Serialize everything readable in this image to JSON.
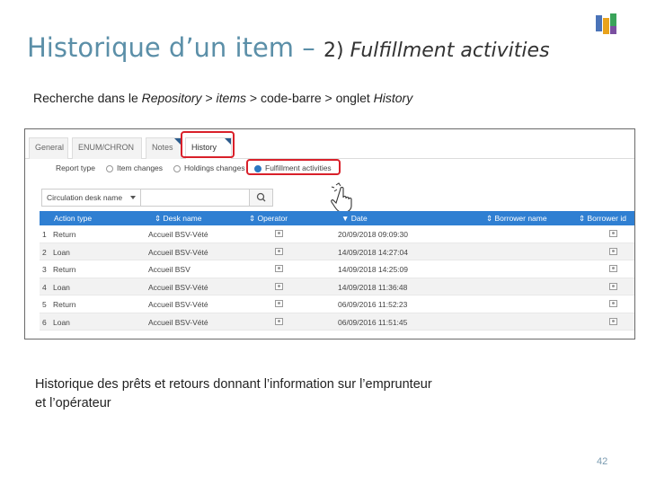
{
  "slide": {
    "title_main": "Historique d’un item – ",
    "title_num": "2) ",
    "title_italic": "Fulfillment activities",
    "subtitle_prefix": "Recherche dans le ",
    "subtitle_repo": "Repository",
    "subtitle_mid": " > ",
    "subtitle_items": "items",
    "subtitle_rest": " > code-barre > onglet ",
    "subtitle_history": "History",
    "body_line1": "Historique des prêts et retours donnant l’information sur l’emprunteur",
    "body_line2": "et l’opérateur",
    "page_number": "42",
    "accent_color": "#5b8fa8",
    "highlight_color": "#d9202a"
  },
  "screenshot": {
    "tabs": [
      "General",
      "ENUM/CHRON",
      "Notes",
      "History"
    ],
    "active_tab": "History",
    "report_type_label": "Report type",
    "report_options": [
      "Item changes",
      "Holdings changes",
      "Fulfillment activities"
    ],
    "selected_report": "Fulfillment activities",
    "filter_dropdown": "Circulation desk name",
    "search_icon": "search-icon",
    "columns": [
      "Action type",
      "Desk name",
      "Operator",
      "Date",
      "Borrower name",
      "Borrower id"
    ],
    "sort_column": "Date",
    "rows": [
      {
        "n": "1",
        "action": "Return",
        "desk": "Accueil BSV-Vété",
        "date": "20/09/2018 09:09:30"
      },
      {
        "n": "2",
        "action": "Loan",
        "desk": "Accueil BSV-Vété",
        "date": "14/09/2018 14:27:04"
      },
      {
        "n": "3",
        "action": "Return",
        "desk": "Accueil BSV",
        "date": "14/09/2018 14:25:09"
      },
      {
        "n": "4",
        "action": "Loan",
        "desk": "Accueil BSV-Vété",
        "date": "14/09/2018 11:36:48"
      },
      {
        "n": "5",
        "action": "Return",
        "desk": "Accueil BSV-Vété",
        "date": "06/09/2016 11:52:23"
      },
      {
        "n": "6",
        "action": "Loan",
        "desk": "Accueil BSV-Vété",
        "date": "06/09/2016 11:51:45"
      }
    ],
    "header_color": "#2f7fd2"
  }
}
